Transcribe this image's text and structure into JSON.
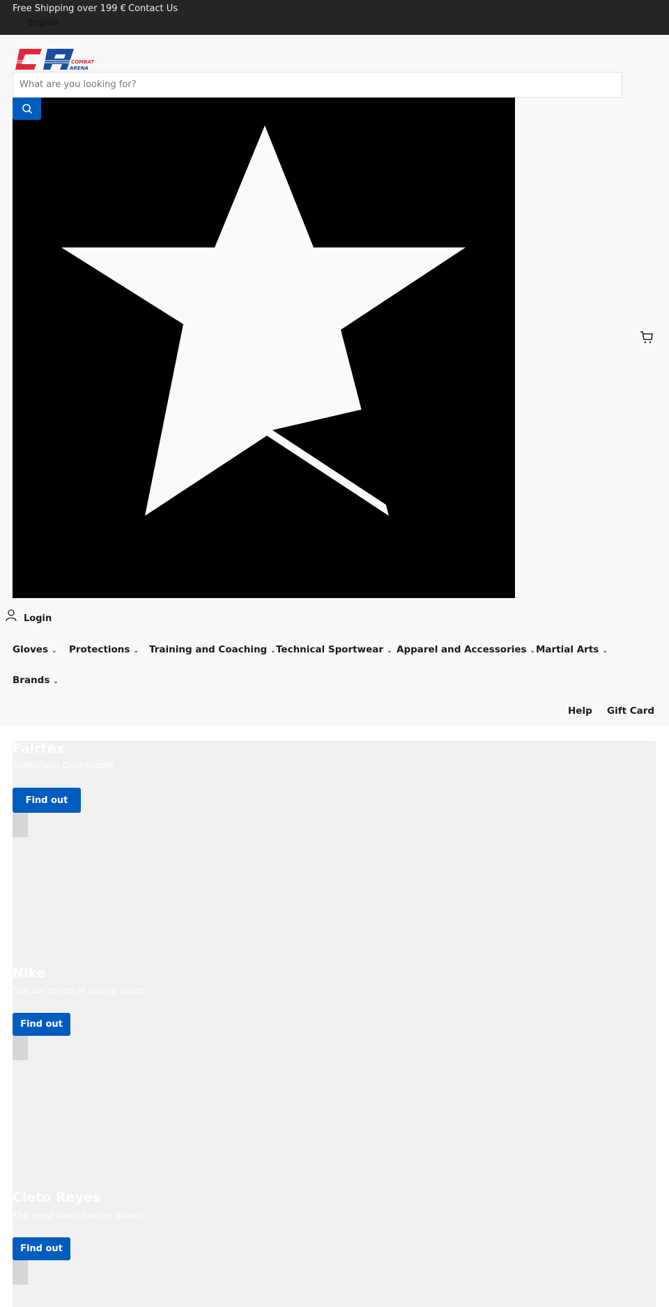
{
  "topbar": {
    "shipping": "Free Shipping over 199 €",
    "contact": "Contact Us",
    "language": "English"
  },
  "brand": {
    "logo_text": "CA COMBAT ARENA",
    "colors": {
      "red": "#e2283a",
      "blue": "#1a4fa0"
    }
  },
  "search": {
    "placeholder": "What are you looking for?",
    "value": ""
  },
  "account": {
    "login": "Login"
  },
  "nav": {
    "items": [
      {
        "label": "Gloves"
      },
      {
        "label": "Protections"
      },
      {
        "label": "Training and Coaching"
      },
      {
        "label": "Technical Sportwear"
      },
      {
        "label": "Apparel and Accessories"
      },
      {
        "label": "Martial Arts"
      },
      {
        "label": "Brands"
      }
    ],
    "secondary": [
      {
        "label": "Help"
      },
      {
        "label": "Gift Card"
      }
    ]
  },
  "slides": [
    {
      "title": "Fairtex",
      "subtitle": "Authorized Distributors",
      "button": "Find out"
    },
    {
      "title": "Nike",
      "subtitle": "See our range of boxing shoes",
      "button": "Find out"
    },
    {
      "title": "Cleto Reyes",
      "subtitle": "The most loved boxing gloves",
      "button": "Find out"
    }
  ],
  "colors": {
    "accent": "#005cbf",
    "topbar": "#252525"
  }
}
